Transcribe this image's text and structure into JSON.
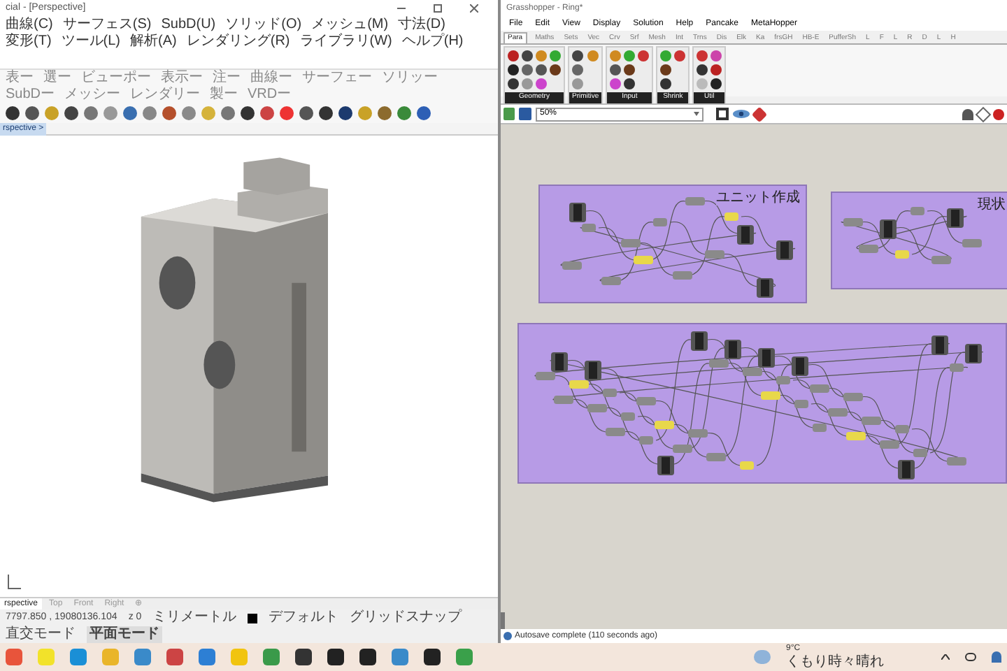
{
  "rhino": {
    "title": "cial - [Perspective]",
    "menu": [
      "曲線(C)",
      "サーフェス(S)",
      "SubD(U)",
      "ソリッド(O)",
      "メッシュ(M)",
      "寸法(D)",
      "変形(T)",
      "ツール(L)",
      "解析(A)",
      "レンダリング(R)",
      "ライブラリ(W)",
      "ヘルプ(H)"
    ],
    "toolbar_tabs": [
      "表ー",
      "選ー",
      "ビューポー",
      "表示ー",
      "注ー",
      "曲線ー",
      "サーフェー",
      "ソリッー",
      "SubDー",
      "メッシー",
      "レンダリー",
      "製ー",
      "VRDー"
    ],
    "viewport_label": "rspective >",
    "viewport_tabs": [
      {
        "label": "rspective",
        "selected": true
      },
      {
        "label": "Top",
        "selected": false
      },
      {
        "label": "Front",
        "selected": false
      },
      {
        "label": "Right",
        "selected": false
      },
      {
        "label": "⊕",
        "selected": false
      }
    ],
    "status": {
      "coords": "7797.850 , 19080136.104",
      "z": "z 0",
      "units": "ミリメートル",
      "layer": "デフォルト",
      "modes": [
        "グリッドスナップ",
        "直交モード",
        "平面モード"
      ]
    }
  },
  "grasshopper": {
    "title": "Grasshopper - Ring*",
    "menu": [
      "File",
      "Edit",
      "View",
      "Display",
      "Solution",
      "Help",
      "Pancake",
      "MetaHopper"
    ],
    "tabs": [
      {
        "label": "Para",
        "selected": true
      },
      {
        "label": "Maths",
        "selected": false
      },
      {
        "label": "Sets",
        "selected": false
      },
      {
        "label": "Vec",
        "selected": false
      },
      {
        "label": "Crv",
        "selected": false
      },
      {
        "label": "Srf",
        "selected": false
      },
      {
        "label": "Mesh",
        "selected": false
      },
      {
        "label": "Int",
        "selected": false
      },
      {
        "label": "Trns",
        "selected": false
      },
      {
        "label": "Dis",
        "selected": false
      },
      {
        "label": "Elk",
        "selected": false
      },
      {
        "label": "Ka",
        "selected": false
      },
      {
        "label": "frsGH",
        "selected": false
      },
      {
        "label": "HB-E",
        "selected": false
      },
      {
        "label": "PufferSh",
        "selected": false
      },
      {
        "label": "L",
        "selected": false
      },
      {
        "label": "F",
        "selected": false
      },
      {
        "label": "L",
        "selected": false
      },
      {
        "label": "R",
        "selected": false
      },
      {
        "label": "D",
        "selected": false
      },
      {
        "label": "L",
        "selected": false
      },
      {
        "label": "H",
        "selected": false
      }
    ],
    "panels": [
      {
        "label": "Geometry"
      },
      {
        "label": "Primitive"
      },
      {
        "label": "Input"
      },
      {
        "label": "Shrink"
      },
      {
        "label": "Util"
      }
    ],
    "zoom": "50%",
    "groups": [
      {
        "title": "ユニット作成"
      },
      {
        "title": "現状"
      }
    ],
    "status": "Autosave complete (110 seconds ago)"
  },
  "taskbar": {
    "weather": {
      "temp": "9°C",
      "desc": "くもり時々晴れ"
    }
  }
}
